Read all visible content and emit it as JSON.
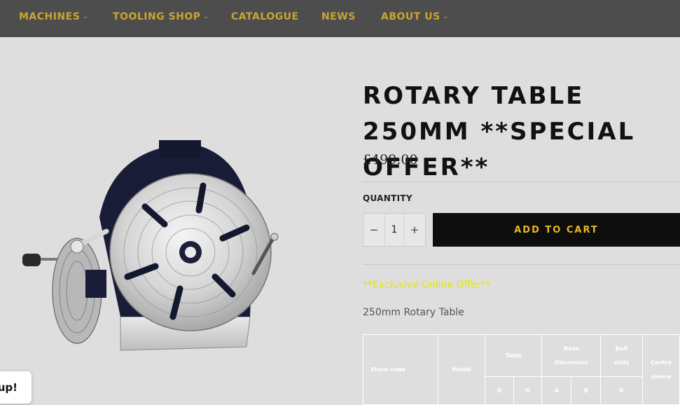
{
  "nav": {
    "items": [
      {
        "label": "MACHINES",
        "has_dropdown": true
      },
      {
        "label": "TOOLING SHOP",
        "has_dropdown": true
      },
      {
        "label": "CATALOGUE",
        "has_dropdown": false
      },
      {
        "label": "NEWS",
        "has_dropdown": false
      },
      {
        "label": "ABOUT US",
        "has_dropdown": true
      }
    ],
    "chevron": "⌄"
  },
  "product": {
    "title": "ROTARY TABLE 250MM **SPECIAL OFFER**",
    "price": "£499.00",
    "quantity_label": "QUANTITY",
    "quantity_value": "1",
    "decrement": "−",
    "increment": "+",
    "add_to_cart": "ADD TO CART",
    "offer_text": "**Exclusive Online Offer**",
    "description": "250mm Rotary Table"
  },
  "spec_table": {
    "stock_code": "Stock-code",
    "model": "Model",
    "table": "Table",
    "base_dimension": "Base Dimension",
    "bolt_slots": "Bolt slots",
    "centre_sleeve": "Centre sleeve",
    "sub_d": "D",
    "sub_h": "H",
    "sub_a": "A",
    "sub_b": "B",
    "sub_k": "K"
  },
  "popup": {
    "text": "up!"
  },
  "colors": {
    "nav_bg": "#4d4d4d",
    "nav_text": "#c9a530",
    "page_bg": "#dedede",
    "cart_bg": "#0d0d0d",
    "cart_text": "#e8b923",
    "offer_text": "#e6e600"
  }
}
